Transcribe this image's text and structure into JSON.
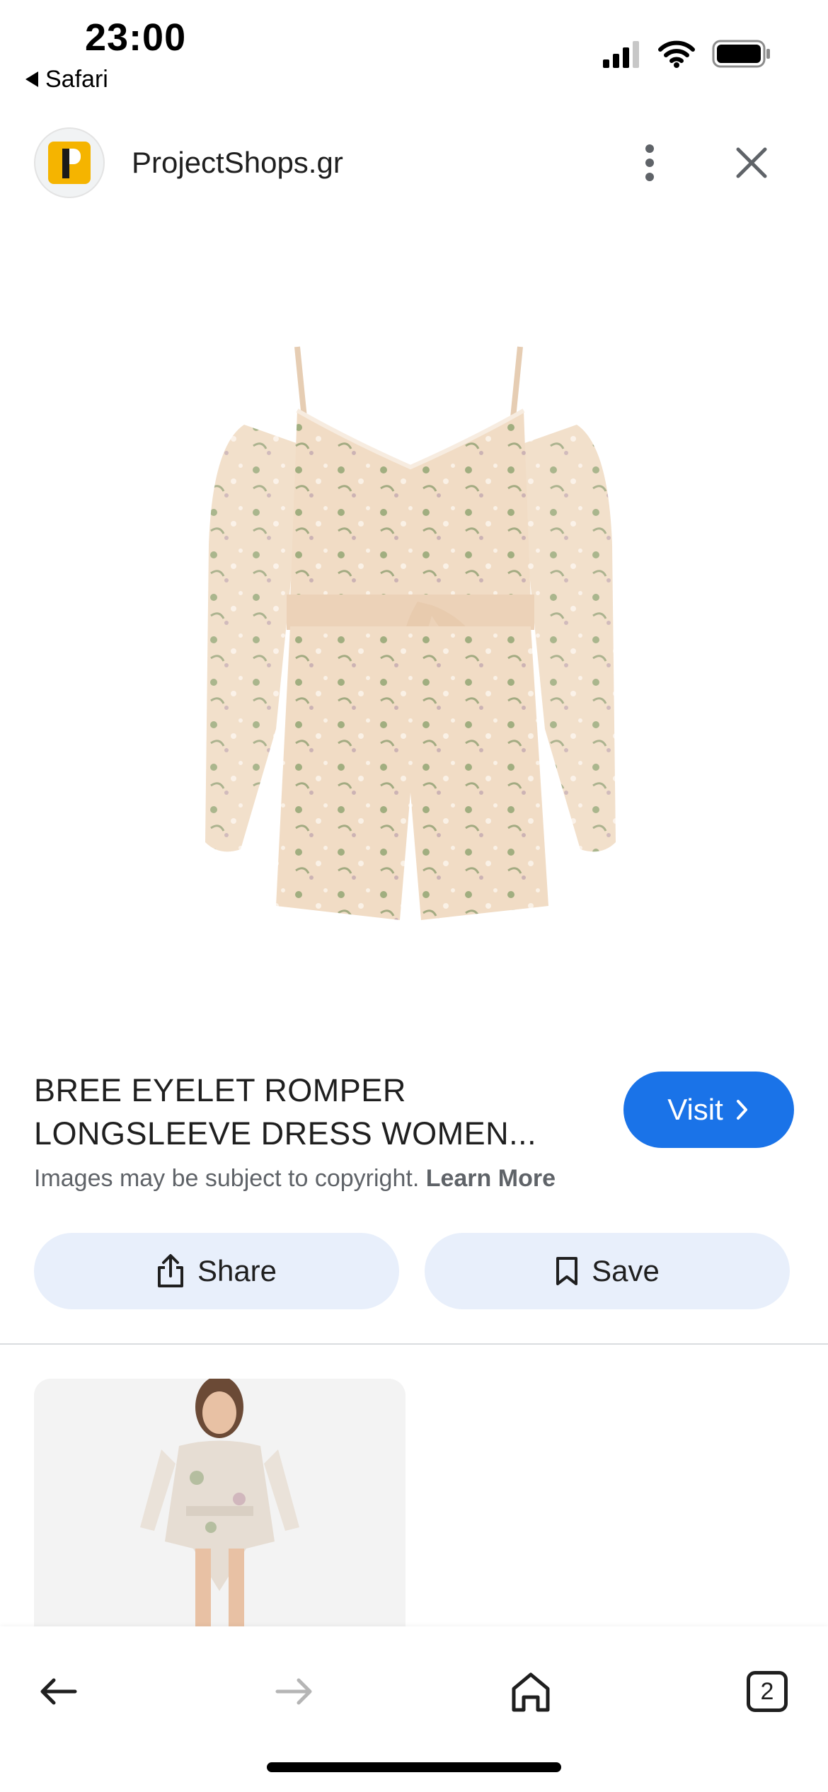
{
  "status_bar": {
    "time": "23:00",
    "back_app_label": "Safari"
  },
  "header": {
    "site_name": "ProjectShops.gr"
  },
  "product": {
    "title_line1": "BREE EYELET ROMPER",
    "title_line2": "LONGSLEEVE DRESS WOMEN...",
    "visit_label": "Visit",
    "copyright_text": "Images may be subject to copyright.",
    "learn_more_label": "Learn More"
  },
  "actions": {
    "share_label": "Share",
    "save_label": "Save"
  },
  "toolbar": {
    "tab_count": "2"
  },
  "colors": {
    "accent": "#1a73e8",
    "action_bg": "#e8effb",
    "logo_yellow": "#f5b400"
  }
}
